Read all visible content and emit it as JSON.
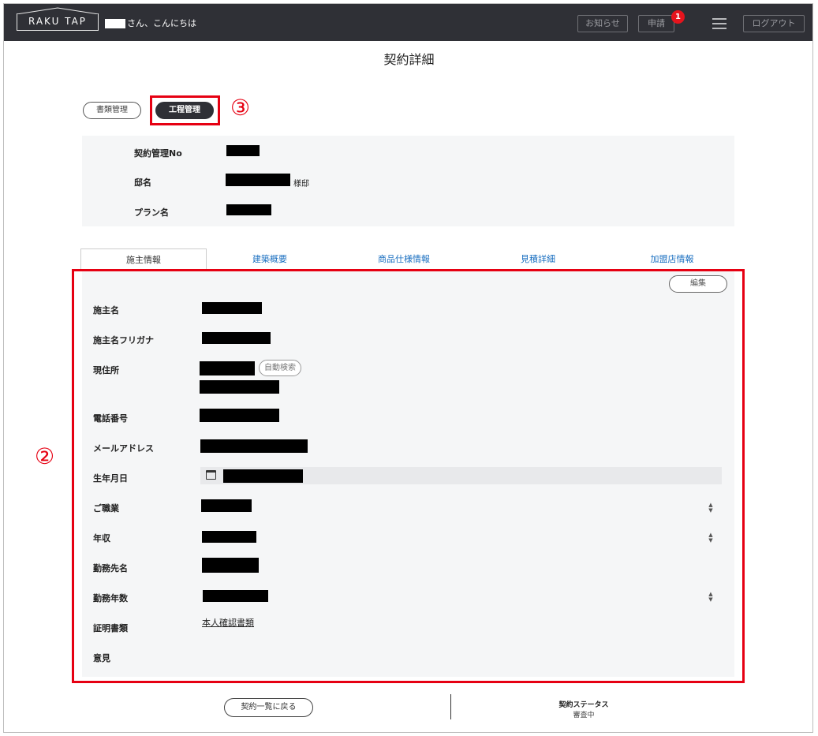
{
  "header": {
    "logo_text": "RAKU TAP",
    "greeting": "さん、こんにちは",
    "notices_label": "お知らせ",
    "apply_label": "申請",
    "apply_badge": "1",
    "logout_label": "ログアウト"
  },
  "page": {
    "title": "契約詳細"
  },
  "top_tabs": {
    "documents": "書類管理",
    "process": "工程管理"
  },
  "annotations": {
    "process_marker": "③",
    "panel_marker": "②"
  },
  "summary": {
    "contract_no_label": "契約管理No",
    "house_name_label": "邸名",
    "house_suffix": "様邸",
    "plan_label": "プラン名"
  },
  "tabs": [
    {
      "label": "施主情報"
    },
    {
      "label": "建築概要"
    },
    {
      "label": "商品仕様情報"
    },
    {
      "label": "見積詳細"
    },
    {
      "label": "加盟店情報"
    }
  ],
  "owner": {
    "edit_label": "編集",
    "name_label": "施主名",
    "kana_label": "施主名フリガナ",
    "address_label": "現住所",
    "auto_search_label": "自動検索",
    "phone_label": "電話番号",
    "email_label": "メールアドレス",
    "birthdate_label": "生年月日",
    "occupation_label": "ご職業",
    "income_label": "年収",
    "employer_label": "勤務先名",
    "years_label": "勤務年数",
    "certificate_label": "証明書類",
    "certificate_link": "本人確認書類",
    "opinion_label": "意見"
  },
  "footer": {
    "back_label": "契約一覧に戻る",
    "status_label": "契約ステータス",
    "status_value": "審査中"
  },
  "colors": {
    "header_bg": "#2f3036",
    "annotation_red": "#e60012",
    "tab_link": "#1a6fc0",
    "badge_red": "#e5141d"
  }
}
